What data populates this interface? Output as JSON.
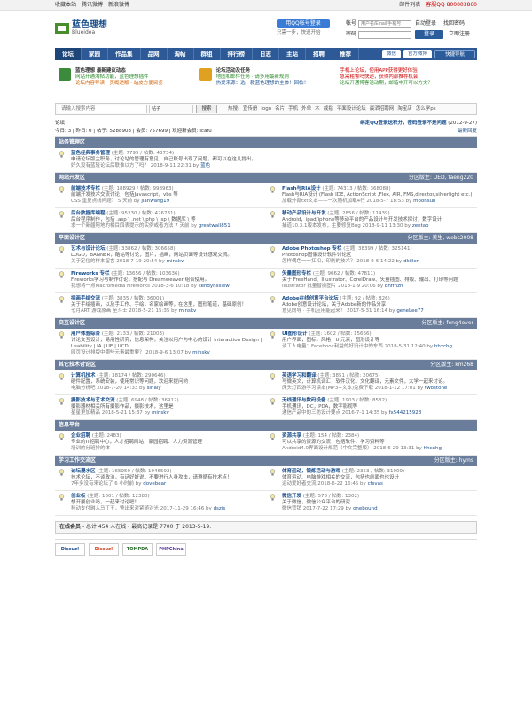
{
  "topbar": {
    "left": [
      "收藏本站",
      "腾讯微博",
      "新浪微博"
    ],
    "right_mail": "邮件列表",
    "right_qq": "客服QQ 800003860"
  },
  "logo": {
    "cn": "蓝色理想",
    "en": "Blueidea"
  },
  "qq_login": {
    "button": "用QQ帐号登录",
    "sub": "只需一步，快速开始"
  },
  "login": {
    "account_label": "帐号",
    "account_placeholder": "用户名/Email/手机号",
    "password_label": "密码",
    "auto_login": "自动登录",
    "find_pwd": "找回密码",
    "login_btn": "登录",
    "register": "立即注册"
  },
  "nav": {
    "items": [
      "论坛",
      "家园",
      "作品集",
      "品网",
      "淘帖",
      "群组",
      "排行榜",
      "日志",
      "主站",
      "招聘",
      "推荐"
    ],
    "right": [
      "微信",
      "官方微博",
      "快捷导航"
    ]
  },
  "promo": [
    {
      "head": "蓝色理想  最新建议动态",
      "l2": "网站开通淘帖功能，蓝色理想插件",
      "l3": "论坛内容导读一页概述版 · 站皮方便阅览"
    },
    {
      "head": "论坛活动及任务",
      "l2": "地图和邮件任务 · 请多用最新规则",
      "l3": "热爱来源：选一款蓝色理想的主体！回帖！"
    },
    {
      "head": "手机上论坛，使用APP获得更好体验",
      "l2": "急需粗鲁吗快递，获得内部推荐机会",
      "l3": "论坛开通博客活动期，邮箱中开可以方文？"
    }
  ],
  "search": {
    "placeholder": "请输入搜索内容",
    "type": "帖子",
    "button": "搜索",
    "hot_label": "热搜:",
    "hot": [
      "宣传册",
      "logo",
      "名片",
      "手机",
      "外单",
      "木",
      "戒指",
      "平面设计论坛",
      "晨洒招聘网",
      "淘宝店",
      "怎么学ps"
    ]
  },
  "crumb": {
    "path": "论坛",
    "right": "绑定QQ登录送积分，密码登录不是问题",
    "date": "(2012-9-27)"
  },
  "stats": {
    "text": "今日: 3 | 昨日: 0 | 帖子: 5288903 | 会员: 757699 | 欢迎新会员: icafu",
    "new": "最新回复"
  },
  "categories": [
    {
      "title": "站务管理区",
      "mod": "",
      "full": true,
      "forums": [
        {
          "name": "蓝色经典事务管理",
          "count": "(主题: 7795 / 帖数: 43734)",
          "desc": "申请论坛版主职务，讨论站的管理有意见，自己账号出现了问题，都可以在这儿提出。",
          "last": "好久没有蓝轻论坛后联谁以方了吗？  2018-9-11 22:31 by ",
          "by": "蓝色"
        }
      ]
    },
    {
      "title": "网站开发区",
      "mod": "分区版主: UED, faeng220",
      "forums": [
        {
          "name": "前端技术专栏",
          "count": "(主题: 188929 / 帖数: 998963)",
          "desc": "前端开发技术交流讨论，包括Javascript，vbs 等",
          "last": "CSS 重复点线问题？  5 天前 by ",
          "by": "jianwang19"
        },
        {
          "name": "Flash与RIA设计",
          "count": "(主题: 74313 / 帖数: 368088)",
          "desc": "Flash与RIA设计 (Flash IDE, ActionScript ,Flex, AIR, FMS,director,silverlight etc.)",
          "last": "加载外部txt文本——一次随机加载4行  2018-5-7 18:53 by ",
          "by": "moonsun"
        },
        {
          "name": "后台数据库编程",
          "count": "(主题: 95230 / 帖数: 426731)",
          "desc": "后台程序制作，包括 .asp \\ .net \\ php \\ jsp \\ 数据库 \\ 等",
          "last": "求一个新疆阿地的相目四表提示的实例或者方法  7 天前 by ",
          "by": "greatwall851"
        },
        {
          "name": "移动产品设计与开发",
          "count": "(主题: 2856 / 帖数: 11439)",
          "desc": "Android，ipad/iphone等移动平台的产品设计与开发技术探讨，数字设计",
          "last": "捕道10.3.1版本发布，主要修复Bug  2018-9-11 13:30 by ",
          "by": "zentao"
        }
      ]
    },
    {
      "title": "平面设计区",
      "mod": "分区版主: 美生, webs2008",
      "forums": [
        {
          "name": "艺术与设计论坛",
          "count": "(主题: 33862 / 帖数: 306658)",
          "desc": "LOGO，BANNER，酷站等讨论；图片，插画，网站页面等设计感观交流。",
          "last": "关于定位的样本留言  2018-7-19 20:54 by ",
          "by": "minskv"
        },
        {
          "name": "Adobe Photoshop 专栏",
          "count": "(主题: 38399 / 帖数: 325141)",
          "desc": "Photoshop图像设计软件讨论区",
          "last": "怎样偶色一一扛扣，印刷的技术？  2018-9-6 14:22 by ",
          "by": "dkiller"
        },
        {
          "name": "Fireworks 专栏",
          "count": "(主题: 13656 / 帖数: 103636)",
          "desc": "Fireworks学习与制作讨论，搭配与 Dreamweaver 组合使用。",
          "last": "我想将一点Macromedia Fireworks  2018-3-6 10:18 by ",
          "by": "kendynsslew"
        },
        {
          "name": "矢量图形专栏",
          "count": "(主题: 9062 / 帖数: 47811)",
          "desc": "关于 FreeHand、Illustrator、CorelDraw、矢量插图、排版、输出、打印等问题",
          "last": "Illustrator 批量替换图片  2018-1-9 20:06 by ",
          "by": "bhffhzh"
        },
        {
          "name": "插画手绘交流",
          "count": "(主题: 3835 / 帖数: 36001)",
          "desc": "关于手绘插画，以及手工作、手绘，名家绘画等，在这里，图形笔道，基础原创！",
          "last": "七月ART 游戏原画  至斗士  2018-5-21 15:35 by ",
          "by": "minskv"
        },
        {
          "name": "Adobe在线创意平台论坛",
          "count": "(主题: 92 / 帖数: 826)",
          "desc": "Adobe创意设计论坛，关于Adobe新的作品分享",
          "last": "意见向导 · 手机应用能起来！  2017-5-31 16:14 by ",
          "by": "geneLee77"
        }
      ]
    },
    {
      "title": "交互设计区",
      "mod": "分区版主: feng4ever",
      "forums": [
        {
          "name": "用户体验综合",
          "count": "(主题: 2133 / 帖数: 21003)",
          "desc": "讨论交互设计，易用性研究，信息架构，关注以用户为中心的设计 Interaction Design | Usability | IA | UE | UCD",
          "last": "网页设计排版中哪些元素最重要？  2018-9-6 13:07 by ",
          "by": "minskv"
        },
        {
          "name": "UI图形设计",
          "count": "(主题: 1602 / 帖数: 15666)",
          "desc": "用户界面，图标，风格，UI元素，图形设计等",
          "last": "谈工人电量：Facebook利益的好设计中的东西  2018-5-31 12:40 by ",
          "by": "hhxchg"
        }
      ]
    },
    {
      "title": "其它技术讨论区",
      "mod": "分区版主: km268",
      "forums": [
        {
          "name": "计算机技术",
          "count": "(主题: 38174 / 帖数: 290646)",
          "desc": "硬件配置，系统安装，使用常识等问题，欢迎来提问哟",
          "last": "电脑分析吧  2018-7-20 14:33 by ",
          "by": "sihaiy"
        },
        {
          "name": "英语学习和翻译",
          "count": "(主题: 3851 / 帖数: 20675)",
          "desc": "写微英文，计算机词汇，软件汉化，文化翻译，元素文件，大学一起来讨论。",
          "last": "床头灯西游学习读本(MP3+文本)免费下载  2018-1-12 17:01 by ",
          "by": "twostone"
        },
        {
          "name": "摄影技术与艺术交流",
          "count": "(主题: 6948 / 帖数: 36912)",
          "desc": "摄影器材相关所有摄影作品，摄影技术，这里是",
          "last": "星星更加精品  2018-5-21 15:37 by ",
          "by": "minskv"
        },
        {
          "name": "无线通讯与数码设备",
          "count": "(主题: 1903 / 帖数: 8532)",
          "desc": "手机通讯，DC，PDA，数字影视等",
          "last": "通信产品中的三防设计要点  2016-7-1 14:35 by ",
          "by": "fx544215928"
        }
      ]
    },
    {
      "title": "信息平台",
      "mod": "",
      "forums": [
        {
          "name": "企业招聘",
          "count": "(主题: 2483)",
          "desc": "专业的IT招聘中心，人才招聘网站，家园招聘：人力资源管理",
          "last": "培训的分班排的体",
          "by": ""
        },
        {
          "name": "资源共享",
          "count": "(主题: 154 / 帖数: 2384)",
          "desc": "可以共享的资源的交流，包括软件，学习资料等",
          "last": "Android4.0界面设计规范（中文完整版）  2018-6-29 13:31 by ",
          "by": "hhxxhg"
        }
      ]
    },
    {
      "title": "学习工作交流区",
      "mod": "分区版主: hyms",
      "forums": [
        {
          "name": "论坛漫水区",
          "count": "(主题: 165959 / 帖数: 1946592)",
          "desc": "技术论坛，不谈政治，有话好好说，不要进行人身攻击，请遵循有技术点！",
          "last": "7年多没有来论坛了  6 小时前 by ",
          "by": "dovebear"
        },
        {
          "name": "体育运动，锻炼活动与游戏",
          "count": "(主题: 2353 / 帖数: 31909)",
          "desc": "体育运动、电脑游戏相关的交流，包括也前面也也设计",
          "last": "运动爱好者交流 2018-6-22 16:45 by ",
          "by": "cfsvas"
        },
        {
          "name": "创业板",
          "count": "(主题: 1601 / 帖数: 12380)",
          "desc": "想开展创业吗，一起来讨论吧！",
          "last": "移动支付融入马丁王，警出来对紧随对光  2017-11-29 16:46 by ",
          "by": "dszjs"
        },
        {
          "name": "微信开发",
          "count": "(主题: 578 / 帖数: 1302)",
          "desc": "关于微信，微信公众平台的研究",
          "last": "微信营销  2017-7-22 17:29 by ",
          "by": "onebound"
        }
      ]
    }
  ],
  "online": {
    "label": "在线会员",
    "text": "- 总计 454 人在线 - 最高记录是 7700 于 2013-5-19."
  },
  "links": [
    "Discuz!",
    "Discuz!",
    "TOMPDA",
    "PHPChina"
  ]
}
